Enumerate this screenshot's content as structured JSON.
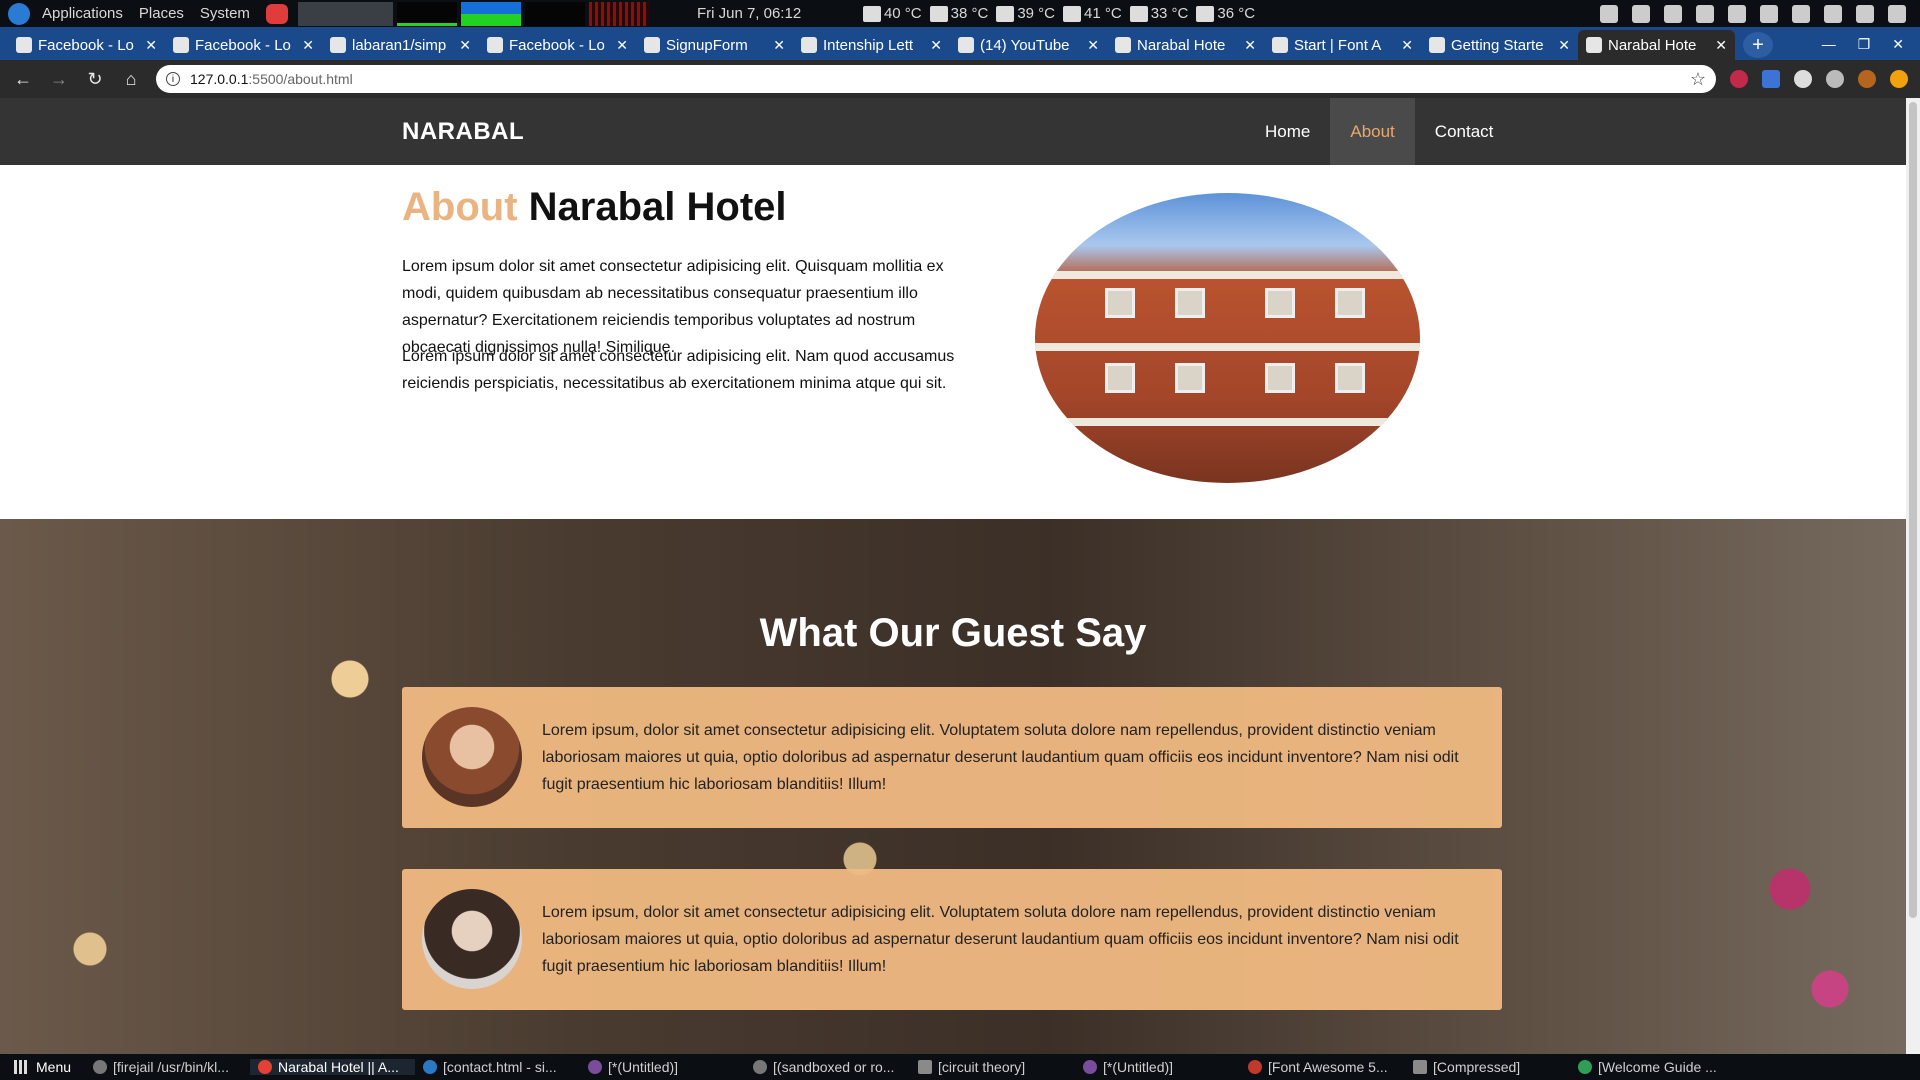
{
  "system_panel": {
    "menus": [
      "Applications",
      "Places",
      "System"
    ],
    "clock": "Fri Jun 7, 06:12",
    "temps": [
      "40 °C",
      "38 °C",
      "39 °C",
      "41 °C",
      "33 °C",
      "36 °C"
    ]
  },
  "browser": {
    "tabs": [
      {
        "title": "Facebook - Lo",
        "icon": "facebook-icon"
      },
      {
        "title": "Facebook - Lo",
        "icon": "facebook-icon"
      },
      {
        "title": "labaran1/simp",
        "icon": "github-icon"
      },
      {
        "title": "Facebook - Lo",
        "icon": "globe-icon"
      },
      {
        "title": "SignupForm",
        "icon": "globe-icon"
      },
      {
        "title": "Intenship Lett",
        "icon": "gmail-icon"
      },
      {
        "title": "(14) YouTube",
        "icon": "youtube-icon"
      },
      {
        "title": "Narabal Hote",
        "icon": "globe-icon"
      },
      {
        "title": "Start | Font A",
        "icon": "flag-icon"
      },
      {
        "title": "Getting Starte",
        "icon": "flag-icon"
      },
      {
        "title": "Narabal Hote",
        "icon": "globe-icon"
      }
    ],
    "active_tab_index": 10,
    "url_host": "127.0.0.1",
    "url_rest": ":5500/about.html"
  },
  "site": {
    "brand": "NARABAL",
    "nav": [
      "Home",
      "About",
      "Contact"
    ],
    "active_nav": "About",
    "accent_color": "#eab382",
    "about": {
      "heading_accent": "About",
      "heading_rest": "Narabal Hotel",
      "paragraph1": "Lorem ipsum dolor sit amet consectetur adipisicing elit. Quisquam mollitia ex modi, quidem quibusdam ab necessitatibus consequatur praesentium illo aspernatur? Exercitationem reiciendis temporibus voluptates ad nostrum obcaecati dignissimos nulla! Similique.",
      "paragraph2": "Lorem ipsum dolor sit amet consectetur adipisicing elit. Nam quod accusamus reiciendis perspiciatis, necessitatibus ab exercitationem minima atque qui sit."
    },
    "guests": {
      "heading": "What Our Guest Say",
      "testimonials": [
        {
          "text": "Lorem ipsum, dolor sit amet consectetur adipisicing elit. Voluptatem soluta dolore nam repellendus, provident distinctio veniam laboriosam maiores ut quia, optio doloribus ad aspernatur deserunt laudantium quam officiis eos incidunt inventore? Nam nisi odit fugit praesentium hic laboriosam blanditiis! Illum!"
        },
        {
          "text": "Lorem ipsum, dolor sit amet consectetur adipisicing elit. Voluptatem soluta dolore nam repellendus, provident distinctio veniam laboriosam maiores ut quia, optio doloribus ad aspernatur deserunt laudantium quam officiis eos incidunt inventore? Nam nisi odit fugit praesentium hic laboriosam blanditiis! Illum!"
        }
      ]
    }
  },
  "taskbar": {
    "menu_label": "Menu",
    "tasks": [
      "[firejail /usr/bin/kl...",
      "Narabal Hotel || A...",
      "[contact.html - si...",
      "[*(Untitled)]",
      "[(sandboxed or ro...",
      "[circuit theory]",
      "[*(Untitled)]",
      "[Font Awesome 5...",
      "[Compressed]",
      "[Welcome Guide ..."
    ]
  }
}
